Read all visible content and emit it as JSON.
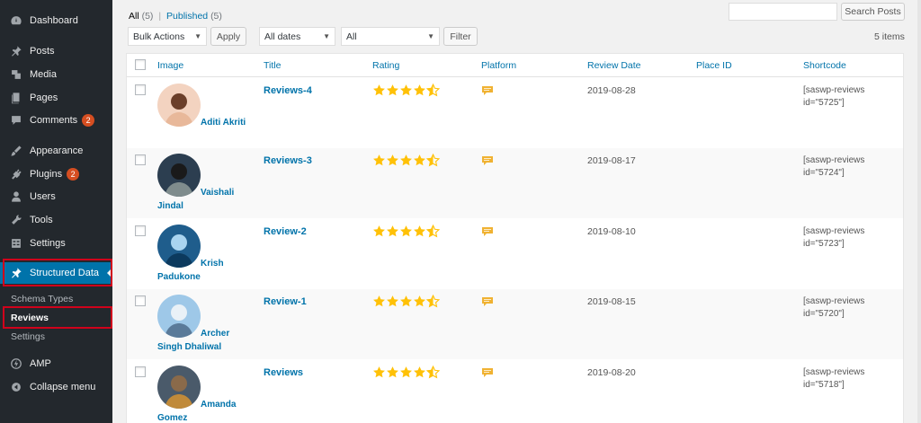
{
  "sidebar": {
    "items": [
      {
        "label": "Dashboard",
        "icon": "dashboard-icon"
      },
      {
        "label": "Posts",
        "icon": "pin-icon"
      },
      {
        "label": "Media",
        "icon": "media-icon"
      },
      {
        "label": "Pages",
        "icon": "pages-icon"
      },
      {
        "label": "Comments",
        "icon": "comment-icon",
        "badge": "2"
      },
      {
        "label": "Appearance",
        "icon": "brush-icon"
      },
      {
        "label": "Plugins",
        "icon": "plugin-icon",
        "badge": "2"
      },
      {
        "label": "Users",
        "icon": "user-icon"
      },
      {
        "label": "Tools",
        "icon": "wrench-icon"
      },
      {
        "label": "Settings",
        "icon": "settings-icon"
      },
      {
        "label": "Structured Data",
        "icon": "pin-icon"
      },
      {
        "label": "AMP",
        "icon": "amp-icon"
      },
      {
        "label": "Collapse menu",
        "icon": "collapse-icon"
      }
    ],
    "submenu": [
      {
        "label": "Schema Types"
      },
      {
        "label": "Reviews"
      },
      {
        "label": "Settings"
      }
    ]
  },
  "filters": {
    "all_label": "All",
    "all_count": "(5)",
    "separator": "|",
    "published_label": "Published",
    "published_count": "(5)",
    "bulk_actions": "Bulk Actions",
    "apply": "Apply",
    "all_dates": "All dates",
    "all": "All",
    "filter": "Filter",
    "search_button": "Search Posts",
    "items_count": "5 items"
  },
  "table": {
    "columns": [
      "Image",
      "Title",
      "Rating",
      "Platform",
      "Review Date",
      "Place ID",
      "Shortcode"
    ],
    "rows": [
      {
        "author": "Aditi Akriti",
        "title": "Reviews-4",
        "rating": 4.5,
        "date": "2019-08-28",
        "shortcode": "[saswp-reviews id=\"5725\"]"
      },
      {
        "author": "Vaishali Jindal",
        "title": "Reviews-3",
        "rating": 4.5,
        "date": "2019-08-17",
        "shortcode": "[saswp-reviews id=\"5724\"]"
      },
      {
        "author": "Krish Padukone",
        "title": "Review-2",
        "rating": 4.5,
        "date": "2019-08-10",
        "shortcode": "[saswp-reviews id=\"5723\"]"
      },
      {
        "author": "Archer Singh Dhaliwal",
        "title": "Review-1",
        "rating": 4.5,
        "date": "2019-08-15",
        "shortcode": "[saswp-reviews id=\"5720\"]"
      },
      {
        "author": "Amanda Gomez",
        "title": "Reviews",
        "rating": 4.5,
        "date": "2019-08-20",
        "shortcode": "[saswp-reviews id=\"5718\"]"
      }
    ]
  },
  "colors": {
    "sidebar_bg": "#23282d",
    "active_bg": "#0073aa",
    "link": "#0073aa",
    "star": "#ffc107",
    "highlight_box": "#d0021b",
    "badge": "#d54e21"
  }
}
